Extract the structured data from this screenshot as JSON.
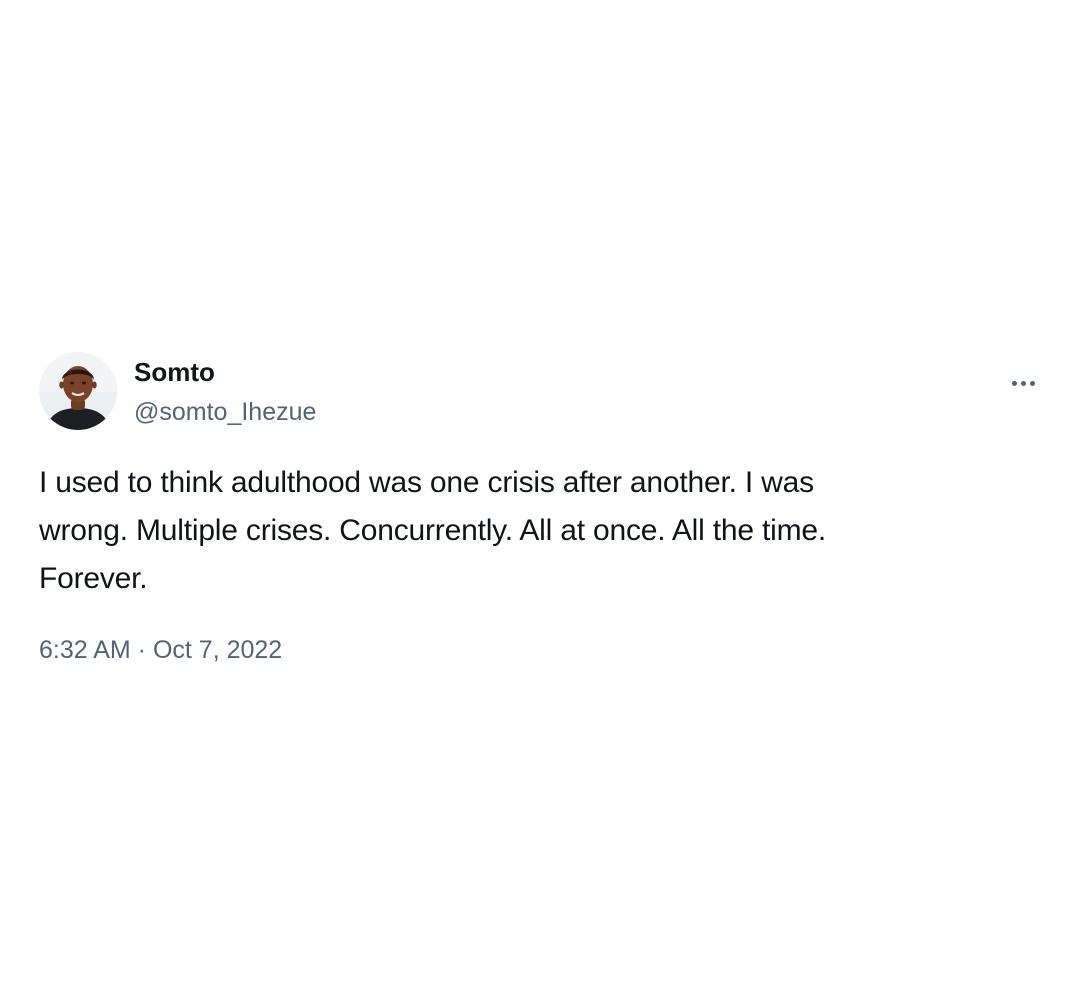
{
  "tweet": {
    "author": {
      "display_name": "Somto",
      "handle": "@somto_Ihezue",
      "avatar_icon": "profile-photo"
    },
    "more_icon": "more-horizontal-icon",
    "text_lines": [
      "I used to think adulthood was one crisis after another. I was",
      "wrong. Multiple crises. Concurrently. All at once. All the time.",
      "Forever."
    ],
    "timestamp": {
      "time": "6:32 AM",
      "separator": " · ",
      "date": "Oct 7, 2022"
    }
  },
  "colors": {
    "background": "#ffffff",
    "primary_text": "#0f1419",
    "secondary_text": "#536471"
  }
}
